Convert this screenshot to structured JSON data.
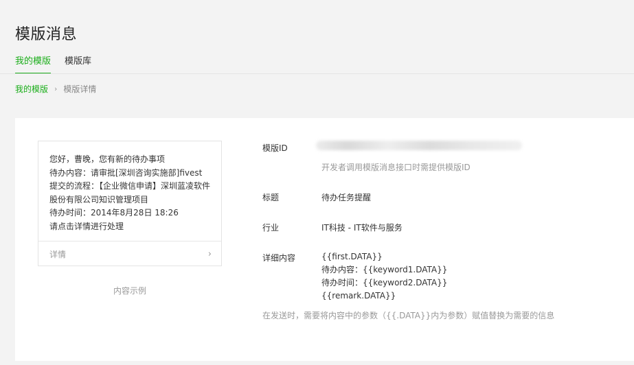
{
  "page": {
    "title": "模版消息"
  },
  "tabs": [
    {
      "label": "我的模版",
      "active": true
    },
    {
      "label": "模版库",
      "active": false
    }
  ],
  "breadcrumb": {
    "link": "我的模版",
    "separator": "›",
    "current": "模版详情"
  },
  "preview": {
    "lines": [
      "您好，曹晚，您有新的待办事项",
      "待办内容：请审批[深圳咨询实施部]fivest提交的流程：【企业微信申请】深圳蓝凌软件股份有限公司知识管理项目",
      "待办时间：2014年8月28日 18:26",
      "请点击详情进行处理"
    ],
    "detail_link": "详情",
    "caption": "内容示例"
  },
  "info": {
    "template_id_label": "模版ID",
    "template_id_hint": "开发者调用模版消息接口时需提供模版ID",
    "title_label": "标题",
    "title_value": "待办任务提醒",
    "industry_label": "行业",
    "industry_value": "IT科技 - IT软件与服务",
    "detail_label": "详细内容",
    "detail_lines": [
      "{{first.DATA}}",
      "待办内容：{{keyword1.DATA}}",
      "待办时间：{{keyword2.DATA}}",
      "{{remark.DATA}}"
    ],
    "note": "在发送时，需要将内容中的参数（{{.DATA}}内为参数）赋值替换为需要的信息"
  }
}
